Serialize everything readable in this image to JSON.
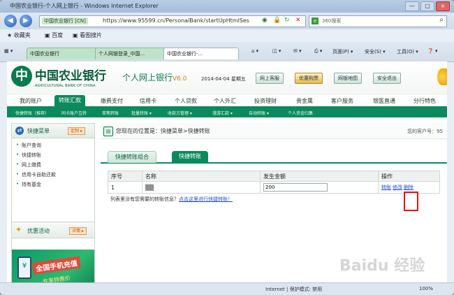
{
  "browser": {
    "title": "中国农业银行-个人网上银行 - Windows Internet Explorer",
    "site_badge": "中国农业银行 [CN]",
    "url": "https://www.95599.cn/PersonalBank/startUpHtmlSes",
    "search_placeholder": "360搜索",
    "window_buttons": [
      "—",
      "□",
      "×"
    ]
  },
  "favbar": {
    "favorites": "收藏夹",
    "baidu": "百度",
    "images": "看图搜片"
  },
  "tabs": [
    {
      "label": "中国农业银行",
      "active": false
    },
    {
      "label": "个人网银登录_中国...",
      "active": false
    },
    {
      "label": "中国农业银行-...",
      "active": true
    }
  ],
  "commands": {
    "page": "页面(P) ▾",
    "safety": "安全(S) ▾",
    "tools": "工具(O) ▾",
    "help": "❓ ▾"
  },
  "bank": {
    "name": "中国农业银行",
    "english": "AGRICULTURAL BANK OF CHINA",
    "product": "个人网上银行",
    "version": "V6.0",
    "date": "2014-04-04 星期五",
    "buttons": [
      "网上客服",
      "优惠购票",
      "网银地图",
      "安全退出"
    ]
  },
  "main_nav": [
    "我的账户",
    "转账汇款",
    "缴费支付",
    "信用卡",
    "个人贷款",
    "个人外汇",
    "投资理财",
    "贵金属",
    "客户服务",
    "银医直通",
    "分行特色"
  ],
  "main_nav_active": "转账汇款",
  "sub_nav": [
    "快捷转账（推荐）",
    "同卡账户互转",
    "单笔转账",
    "批量转账 ▾",
    "收款方管理 ▾",
    "漫游汇款 ▾",
    "自动转账 ▾",
    "个人资金归集"
  ],
  "sidebar": {
    "title": "快捷菜单",
    "config": "定制 ▸",
    "items": [
      "账户查询",
      "快捷转账",
      "网上缴费",
      "信用卡自助还款",
      "持有基金"
    ],
    "activity_title": "优惠活动",
    "activity_more": "详情 ▸",
    "banner_line1": "全国手机充值",
    "banner_line2": "专享特惠价"
  },
  "content": {
    "breadcrumb": "您现在的位置是：快捷菜单>快捷转账",
    "customer_no": "您的客户号：95",
    "tab_combo": "快捷转账组合",
    "tab_transfer": "快捷转账",
    "columns": [
      "序号",
      "名称",
      "发生金额",
      "操作"
    ],
    "rows": [
      {
        "index": "1",
        "name": "▒▒",
        "amount": "200",
        "actions": [
          "转账",
          "修改",
          "删除"
        ]
      }
    ],
    "hint": "列表里没有您需要的转账信息？",
    "hint_link": "点击这里进行快捷转账！"
  },
  "statusbar": {
    "internet": "Internet | 保护模式: 禁用",
    "zoom": "100%"
  },
  "watermark": "Baidu 经验"
}
